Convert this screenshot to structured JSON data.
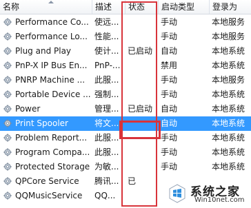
{
  "columns": {
    "name": "名称",
    "desc": "描述",
    "status": "状态",
    "startup": "启动类型",
    "login": "登录为"
  },
  "rows": [
    {
      "name": "Performance Co...",
      "desc": "使远...",
      "status": "",
      "startup": "手动",
      "login": "本地服务"
    },
    {
      "name": "Performance Lo...",
      "desc": "性能...",
      "status": "",
      "startup": "手动",
      "login": "本地服务"
    },
    {
      "name": "Plug and Play",
      "desc": "使计...",
      "status": "已启动",
      "startup": "自动",
      "login": "本地系统"
    },
    {
      "name": "PnP-X IP Bus En...",
      "desc": "PnP-...",
      "status": "",
      "startup": "禁用",
      "login": "本地系统"
    },
    {
      "name": "PNRP Machine ...",
      "desc": "此服...",
      "status": "",
      "startup": "手动",
      "login": "本地服务"
    },
    {
      "name": "Portable Device ...",
      "desc": "强制...",
      "status": "",
      "startup": "手动",
      "login": "本地系统"
    },
    {
      "name": "Power",
      "desc": "管理...",
      "status": "已启动",
      "startup": "自动",
      "login": "本地系统"
    },
    {
      "name": "Print Spooler",
      "desc": "将文...",
      "status": "",
      "startup": "自动",
      "login": "本地系统",
      "selected": true
    },
    {
      "name": "Problem Report...",
      "desc": "此服...",
      "status": "",
      "startup": "手动",
      "login": "本地系统"
    },
    {
      "name": "Program Compa...",
      "desc": "此服...",
      "status": "",
      "startup": "手动",
      "login": "本地系统"
    },
    {
      "name": "Protected Storage",
      "desc": "为敏...",
      "status": "",
      "startup": "手动",
      "login": "本地系统"
    },
    {
      "name": "QPCore Service",
      "desc": "腾讯...",
      "status": "已",
      "startup": "",
      "login": ""
    },
    {
      "name": "QQMusicService",
      "desc": "QQ...",
      "status": "",
      "startup": "",
      "login": ""
    }
  ],
  "watermark": {
    "text": "系统之家",
    "url": "Win10net.com"
  },
  "colors": {
    "selection": "#3399ff",
    "highlight_box": "#d8333a"
  },
  "icons": {
    "row_icon": "gear-icon",
    "watermark_logo": "windows-logo-icon",
    "sort": "sort-caret-icon"
  }
}
